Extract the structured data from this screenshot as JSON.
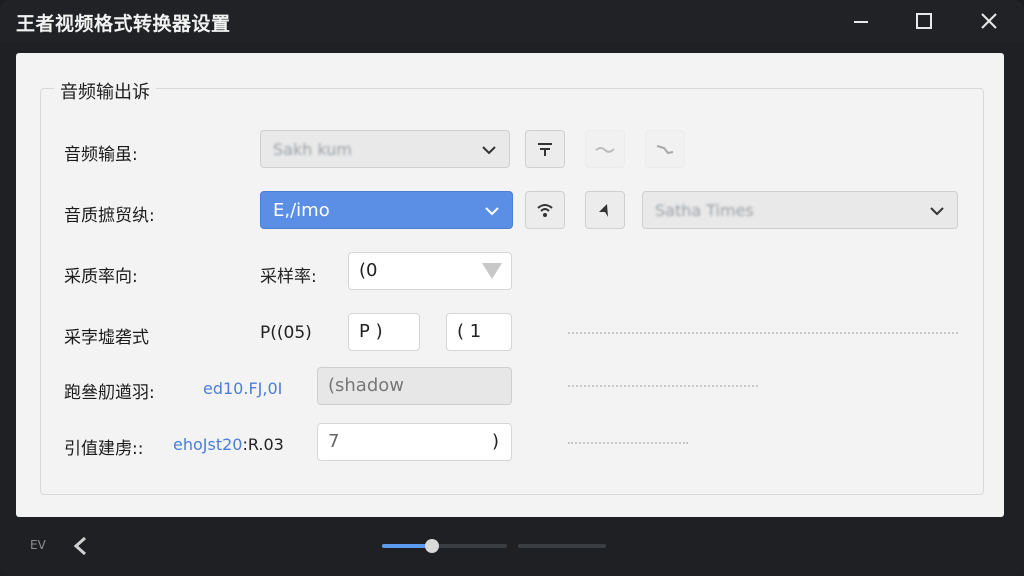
{
  "window": {
    "title": "王者视频格式转换器设置"
  },
  "group": {
    "legend": "音频输出诉"
  },
  "rows": [
    {
      "label": "音频输虽:",
      "select_value": "Sakh kum"
    },
    {
      "label": "音质摭贸纨:",
      "select_value": "E,/imo",
      "select2_value": "Satha Times"
    },
    {
      "label": "采质率向:",
      "inline_label": "采样率:",
      "field_value": "(0"
    },
    {
      "label": "采孛墟砻式",
      "inline_label": "P((05)",
      "field1_value": "P )",
      "field2_value": "( 1"
    },
    {
      "label": "跑叄舠遒羽:",
      "inline_label": "ed10.FJ,0I",
      "field_value": "(shadow"
    },
    {
      "label": "引值建虏::",
      "inline_label_prefix": "ehoJst20",
      "inline_label_suffix": ":R.03",
      "field_value": "7",
      "field_end": ")"
    }
  ],
  "bottom": {
    "ev_label": "EV",
    "slider_level": 0.4
  },
  "colors": {
    "accent": "#5b8fe6",
    "titlebar": "#202226",
    "panel": "#f3f3f3"
  }
}
